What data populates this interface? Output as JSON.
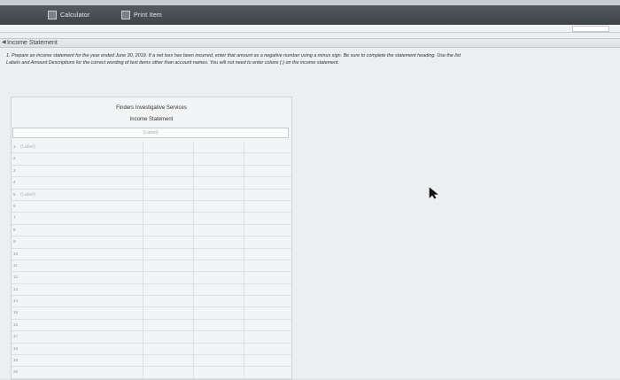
{
  "toolbar": {
    "calculator_label": "Calculator",
    "print_label": "Print Item"
  },
  "section": {
    "title": "Income Statement"
  },
  "instructions": {
    "line1": "1. Prepare an income statement for the year ended June 30, 2019. If a net loss has been incurred, enter that amount as a negative number using a minus sign. Be sure to complete the statement heading. Use the list",
    "line2": "Labels and Amount Descriptions for the correct wording of text items other than account names. You will not need to enter colons (:) on the income statement."
  },
  "statement": {
    "company": "Finders Investigative Services",
    "title": "Income Statement",
    "label_placeholder": "(Label)",
    "rows": [
      {
        "num": "1",
        "label": "(Label)"
      },
      {
        "num": "2",
        "label": ""
      },
      {
        "num": "3",
        "label": ""
      },
      {
        "num": "4",
        "label": ""
      },
      {
        "num": "5",
        "label": "(Label)"
      },
      {
        "num": "6",
        "label": ""
      },
      {
        "num": "7",
        "label": ""
      },
      {
        "num": "8",
        "label": ""
      },
      {
        "num": "9",
        "label": ""
      },
      {
        "num": "10",
        "label": ""
      },
      {
        "num": "11",
        "label": ""
      },
      {
        "num": "12",
        "label": ""
      },
      {
        "num": "13",
        "label": ""
      },
      {
        "num": "14",
        "label": ""
      },
      {
        "num": "15",
        "label": ""
      },
      {
        "num": "16",
        "label": ""
      },
      {
        "num": "17",
        "label": ""
      },
      {
        "num": "18",
        "label": ""
      },
      {
        "num": "19",
        "label": ""
      },
      {
        "num": "20",
        "label": ""
      }
    ]
  }
}
